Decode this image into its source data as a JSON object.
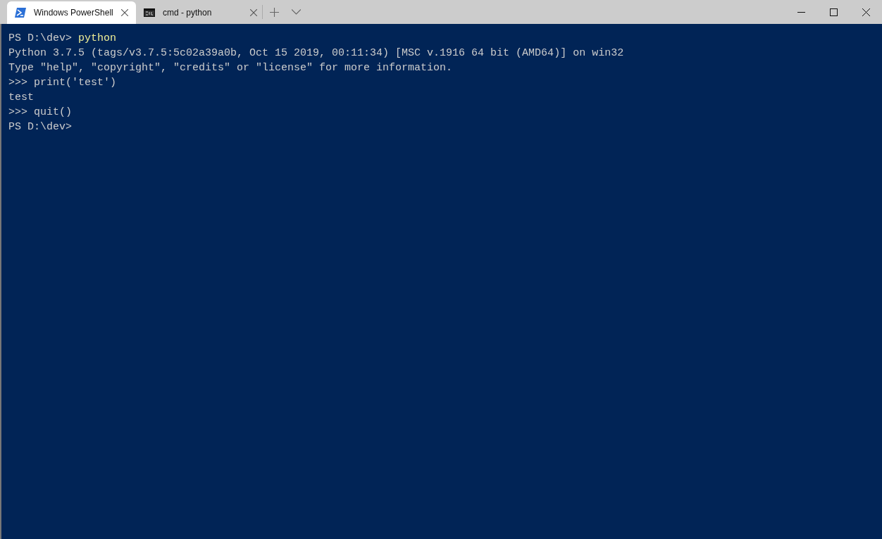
{
  "tabs": [
    {
      "title": "Windows PowerShell",
      "kind": "powershell",
      "selected": true
    },
    {
      "title": "cmd - python",
      "kind": "cmd",
      "selected": false
    }
  ],
  "lines": [
    {
      "kind": "input",
      "prompt": "PS D:\\dev>",
      "command": "python",
      "highlighted": true
    },
    {
      "kind": "output",
      "text": "Python 3.7.5 (tags/v3.7.5:5c02a39a0b, Oct 15 2019, 00:11:34) [MSC v.1916 64 bit (AMD64)] on win32"
    },
    {
      "kind": "output",
      "text": "Type \"help\", \"copyright\", \"credits\" or \"license\" for more information."
    },
    {
      "kind": "input",
      "prompt": ">>>",
      "command": "print('test')",
      "highlighted": false
    },
    {
      "kind": "output",
      "text": "test"
    },
    {
      "kind": "input",
      "prompt": ">>>",
      "command": "quit()",
      "highlighted": false
    },
    {
      "kind": "input",
      "prompt": "PS D:\\dev>"
    }
  ]
}
